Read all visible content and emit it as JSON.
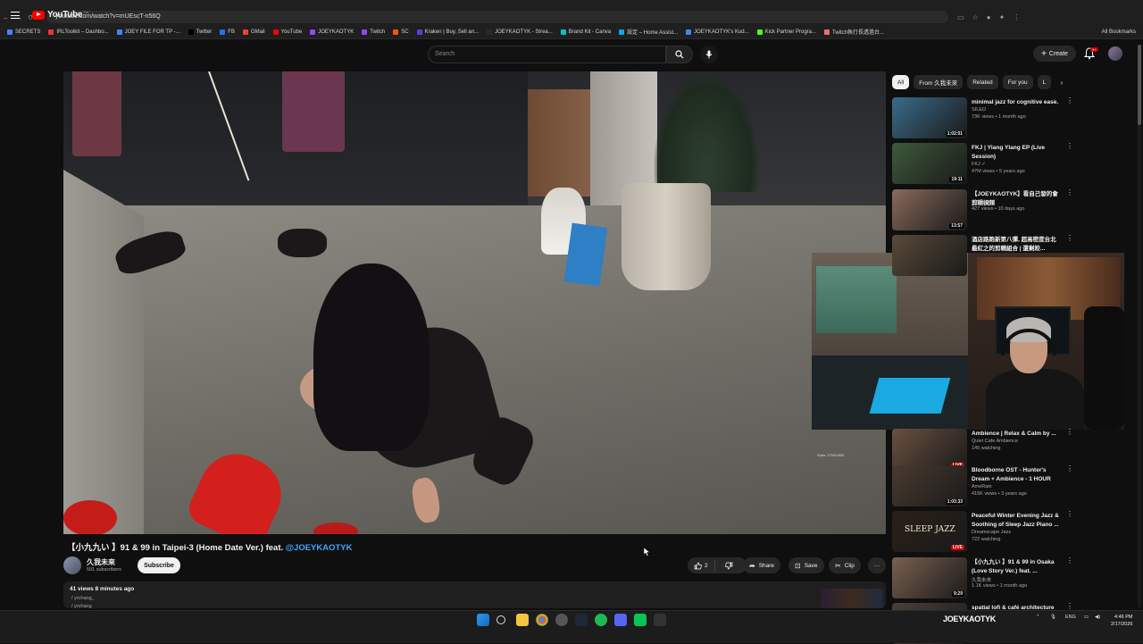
{
  "browser": {
    "url": "youtube.com/watch?v=mUEscT-n56Q",
    "bookmarks": [
      {
        "label": "SECRETS",
        "color": "#4285f4"
      },
      {
        "label": "IRLToolkit – Dashbo...",
        "color": "#e53935"
      },
      {
        "label": "JOEY FILE FOR TP -...",
        "color": "#4285f4"
      },
      {
        "label": "Twitter",
        "color": "#000000"
      },
      {
        "label": "FB",
        "color": "#1877f2"
      },
      {
        "label": "GMail",
        "color": "#ea4335"
      },
      {
        "label": "YouTube",
        "color": "#ff0000"
      },
      {
        "label": "JOEYKAOTYK",
        "color": "#9146ff"
      },
      {
        "label": "Twitch",
        "color": "#9146ff"
      },
      {
        "label": "SC",
        "color": "#ff5500"
      },
      {
        "label": "Kraken | Buy, Sell an...",
        "color": "#5741d9"
      },
      {
        "label": "JOEYKAOTYK - Strea...",
        "color": "#2a2a2a"
      },
      {
        "label": "Brand Kit - Canva",
        "color": "#00c4cc"
      },
      {
        "label": "設定 – Home Assist...",
        "color": "#03a9f4"
      },
      {
        "label": "JOEYKAOTYK's Kud...",
        "color": "#4285f4"
      },
      {
        "label": "Kick Partner Progra...",
        "color": "#53fc18"
      },
      {
        "label": "Twitch執行長透過台...",
        "color": "#e57373"
      }
    ],
    "all_bookmarks": "All Bookmarks"
  },
  "header": {
    "logo_text": "YouTube",
    "logo_tm": "TW",
    "search_placeholder": "Search",
    "create_label": "Create",
    "notif_count": "9+"
  },
  "video": {
    "title_prefix": "【小九九い 】91 & 99 in Taipei-3 (Home Date Ver.) feat. ",
    "title_mention": "@JOEYKAOTYK",
    "channel_name": "久我未來",
    "channel_subs": "591 subscribers",
    "subscribe_label": "Subscribe",
    "likes": "2",
    "share_label": "Share",
    "save_label": "Save",
    "clip_label": "Clip",
    "views_time": "41 views  8 minutes ago",
    "desc_line1": "/ yrchang_",
    "desc_line2": "/ yrchang",
    "overlay_text": "Subs: 2703/2500"
  },
  "chips": [
    {
      "label": "All",
      "active": true
    },
    {
      "label": "From 久我未來",
      "active": false
    },
    {
      "label": "Related",
      "active": false
    },
    {
      "label": "For you",
      "active": false
    },
    {
      "label": "L",
      "active": false
    }
  ],
  "recommendations": [
    {
      "title": "minimal jazz for cognitive ease.",
      "channel": "SILEO",
      "meta": "73K views • 1 month ago",
      "duration": "1:02:01",
      "live": false,
      "thumb": "#3a6b8a"
    },
    {
      "title": "FKJ | Ylang Ylang EP (Live Session)",
      "channel": "FKJ ✓",
      "meta": "47M views • 5 years ago",
      "duration": "19:11",
      "live": false,
      "thumb": "#3d5a3a"
    },
    {
      "title": "【JOEYKAOTYK】看自己發的會剪輯視頻",
      "channel": "久我未來",
      "meta": "427 views • 10 days ago",
      "duration": "13:57",
      "live": false,
      "thumb": "#8a6a5a"
    },
    {
      "title": "酒店路跑新第八彈, 超高密度台北 最紅之的剪輯組合 | 還剩皎...",
      "channel": "",
      "meta": "",
      "duration": "",
      "live": false,
      "thumb": "#5a4a3a"
    },
    {
      "title": "Ambience | Relax & Calm by ...",
      "channel": "Quiet Cafe Ambience",
      "meta": "145 watching",
      "duration": "LIVE",
      "live": true,
      "thumb": "#6a5040"
    },
    {
      "title": "Bloodborne OST - Hunter's Dream + Ambience - 1 HOUR",
      "channel": "AmeRain",
      "meta": "415K views • 3 years ago",
      "duration": "1:03:33",
      "live": false,
      "thumb": "#4a3a30"
    },
    {
      "title": "Peaceful Winter Evening Jazz & Soothing of Sleep Jazz Piano ...",
      "channel": "Dreamscape Jazz",
      "meta": "722 watching",
      "duration": "LIVE",
      "live": true,
      "thumb": "#2a2018"
    },
    {
      "title": "【小九九い 】91 & 99 in Osaka (Love Story Ver.) feat. ...",
      "channel": "久我未來",
      "meta": "1.1K views • 1 month ago",
      "duration": "9:29",
      "live": false,
      "thumb": "#7a6050"
    },
    {
      "title": "spatial lofi & café architecture",
      "channel": "",
      "meta": "",
      "duration": "",
      "live": false,
      "thumb": "#4a4038"
    }
  ],
  "thumb_text": {
    "jazz": "SLEEP JAZZ"
  },
  "taskbar": {
    "watermark": "JOEYKAOTYK",
    "lang": "ENG",
    "time": "4:46 PM",
    "date": "2/17/2026"
  }
}
